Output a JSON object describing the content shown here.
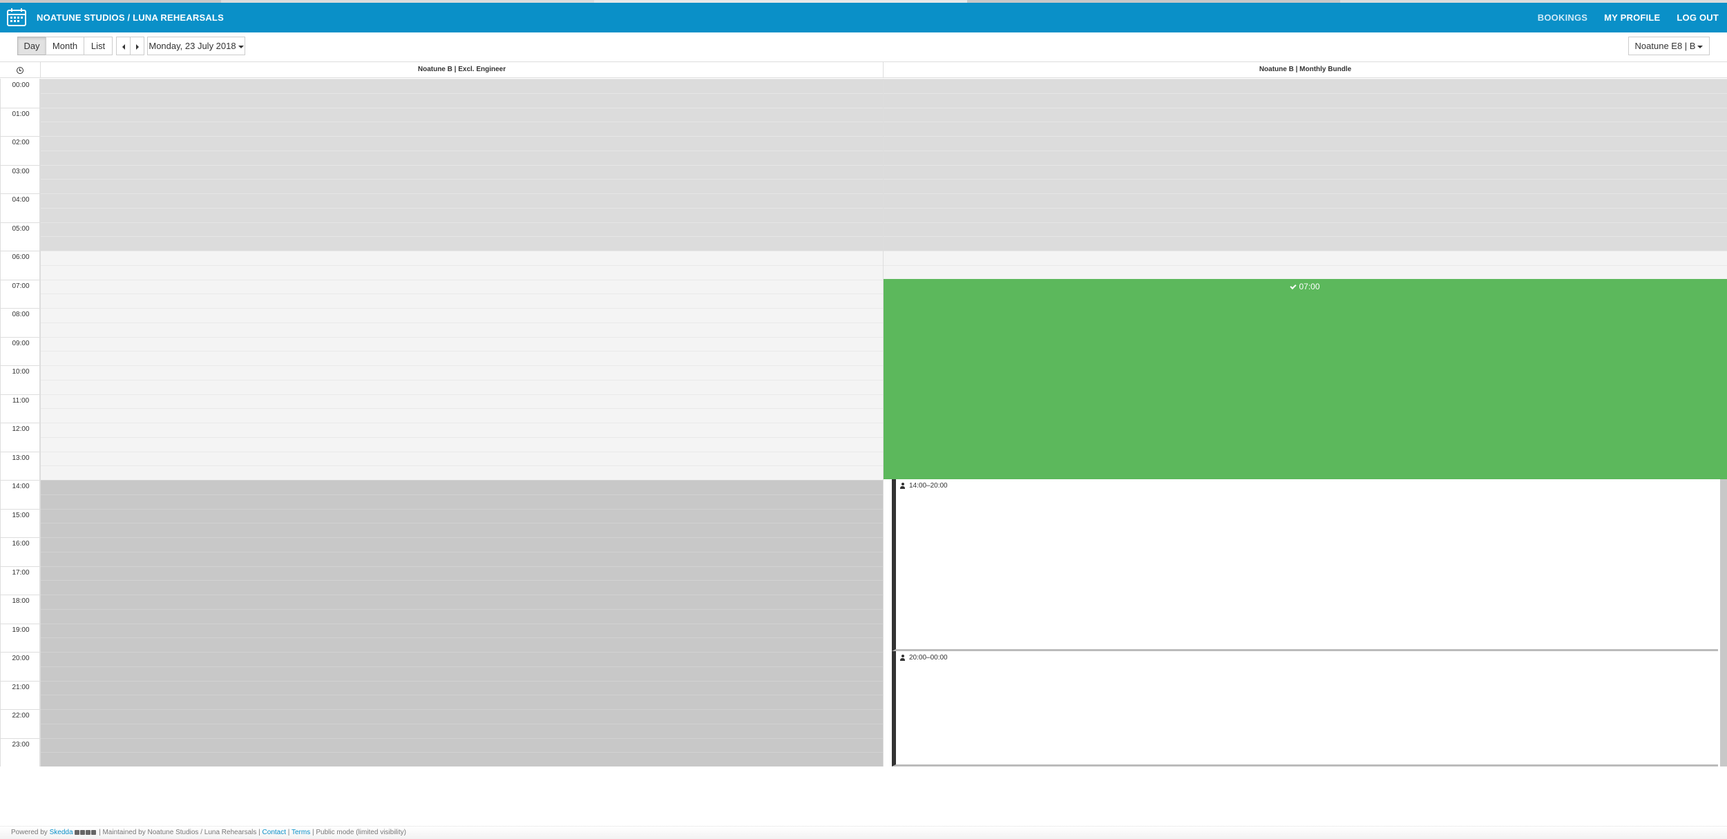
{
  "colors": {
    "header_bg": "#0a90c8",
    "booked": "#5cb85c",
    "unavailable": "#c8c8c8",
    "closed": "#dcdcdc",
    "open": "#f4f4f4"
  },
  "header": {
    "brand": "NOATUNE STUDIOS / LUNA REHEARSALS",
    "nav": {
      "bookings": "BOOKINGS",
      "profile": "MY PROFILE",
      "logout": "LOG OUT"
    }
  },
  "toolbar": {
    "view_day": "Day",
    "view_month": "Month",
    "view_list": "List",
    "date": "Monday, 23 July 2018",
    "space_select": "Noatune E8 | B"
  },
  "calendar": {
    "columns": [
      {
        "label": "Noatune B | Excl. Engineer"
      },
      {
        "label": "Noatune B | Monthly Bundle"
      }
    ],
    "hours": [
      "00:00",
      "01:00",
      "02:00",
      "03:00",
      "04:00",
      "05:00",
      "06:00",
      "07:00",
      "08:00",
      "09:00",
      "10:00",
      "11:00",
      "12:00",
      "13:00",
      "14:00",
      "15:00",
      "16:00",
      "17:00",
      "18:00",
      "19:00",
      "20:00",
      "21:00",
      "22:00",
      "23:00"
    ],
    "events": {
      "available_block": "07:00",
      "slot_afternoon": "14:00–20:00",
      "slot_evening": "20:00–00:00"
    }
  },
  "footer": {
    "powered_by": "Powered by",
    "skedda": "Skedda",
    "maintained": "| Maintained by Noatune Studios / Luna Rehearsals |",
    "contact": "Contact",
    "sep": "|",
    "terms": "Terms",
    "mode": "| Public mode (limited visibility)"
  }
}
